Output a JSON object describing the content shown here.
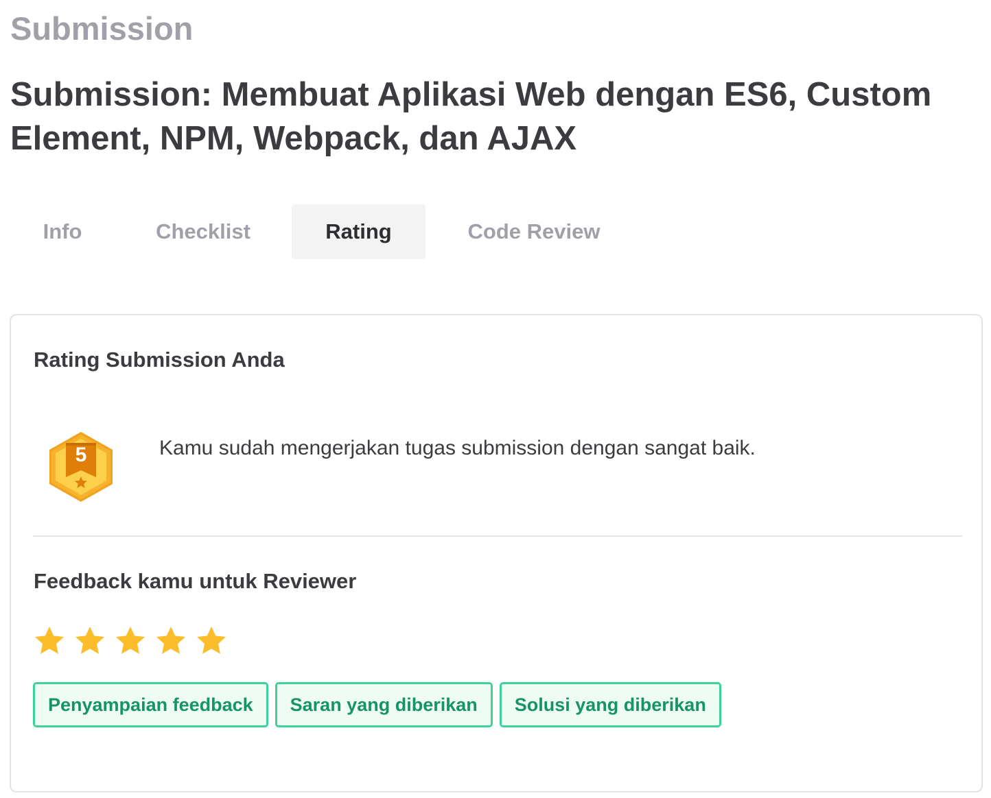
{
  "header": {
    "eyebrow": "Submission",
    "title": "Submission: Membuat Aplikasi Web dengan ES6, Custom Element, NPM, Webpack, dan AJAX"
  },
  "tabs": [
    {
      "label": "Info",
      "active": false
    },
    {
      "label": "Checklist",
      "active": false
    },
    {
      "label": "Rating",
      "active": true
    },
    {
      "label": "Code Review",
      "active": false
    }
  ],
  "rating_section": {
    "heading": "Rating Submission Anda",
    "badge_icon": "hexagon-ribbon-star-badge-icon",
    "badge_value": "5",
    "message": "Kamu sudah mengerjakan tugas submission dengan sangat baik."
  },
  "feedback_section": {
    "heading": "Feedback kamu untuk Reviewer",
    "stars_filled": 5,
    "stars_total": 5,
    "star_color": "#fbbd2a",
    "chips": [
      {
        "label": "Penyampaian feedback"
      },
      {
        "label": "Saran yang diberikan"
      },
      {
        "label": "Solusi yang diberikan"
      }
    ]
  },
  "colors": {
    "muted_text": "#a0a1a8",
    "heading_text": "#3b3b40",
    "chip_border": "#3ed29a",
    "chip_background": "#eefcf5",
    "chip_text": "#179467",
    "badge_orange": "#f5a623",
    "badge_yellow": "#fcd04b"
  }
}
